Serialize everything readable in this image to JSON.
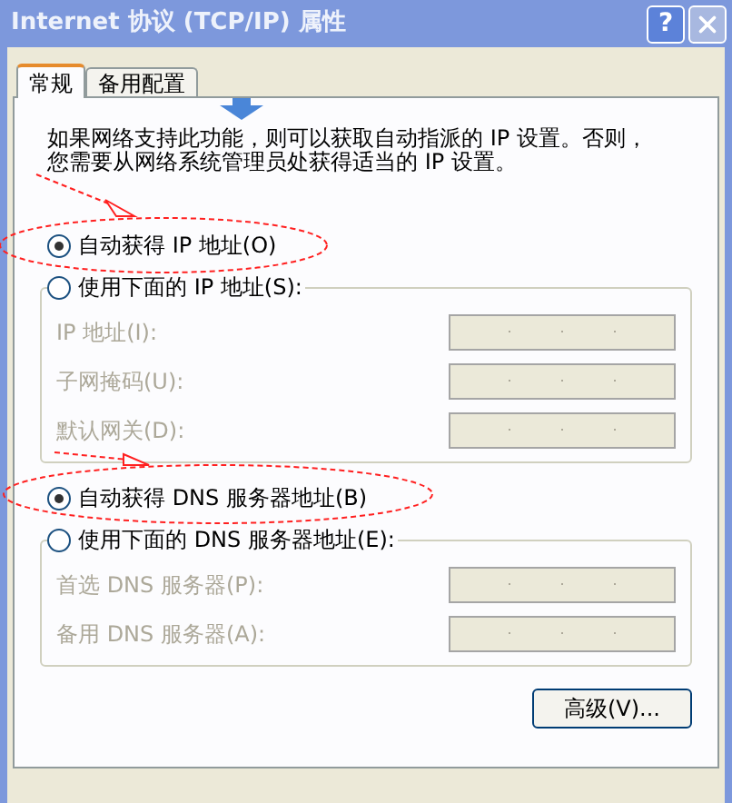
{
  "window": {
    "title": "Internet 协议 (TCP/IP) 属性",
    "help": "?"
  },
  "tabs": [
    {
      "label": "常规",
      "selected": true
    },
    {
      "label": "备用配置",
      "selected": false
    }
  ],
  "description": [
    "如果网络支持此功能，则可以获取自动指派的 IP 设置。否则，",
    "您需要从网络系统管理员处获得适当的 IP 设置。"
  ],
  "ip_mode": [
    {
      "label": "自动获得 IP 地址(O)",
      "selected": true
    },
    {
      "label": "使用下面的 IP 地址(S):",
      "selected": false
    }
  ],
  "ip_fields": [
    {
      "label": "IP 地址(I):",
      "disabled": true
    },
    {
      "label": "子网掩码(U):",
      "disabled": true
    },
    {
      "label": "默认网关(D):",
      "disabled": true
    }
  ],
  "dns_mode": [
    {
      "label": "自动获得 DNS 服务器地址(B)",
      "selected": true
    },
    {
      "label": "使用下面的 DNS 服务器地址(E):",
      "selected": false
    }
  ],
  "dns_fields": [
    {
      "label": "首选 DNS 服务器(P):",
      "disabled": true
    },
    {
      "label": "备用 DNS 服务器(A):",
      "disabled": true
    }
  ],
  "advanced_button": "高级(V)..."
}
